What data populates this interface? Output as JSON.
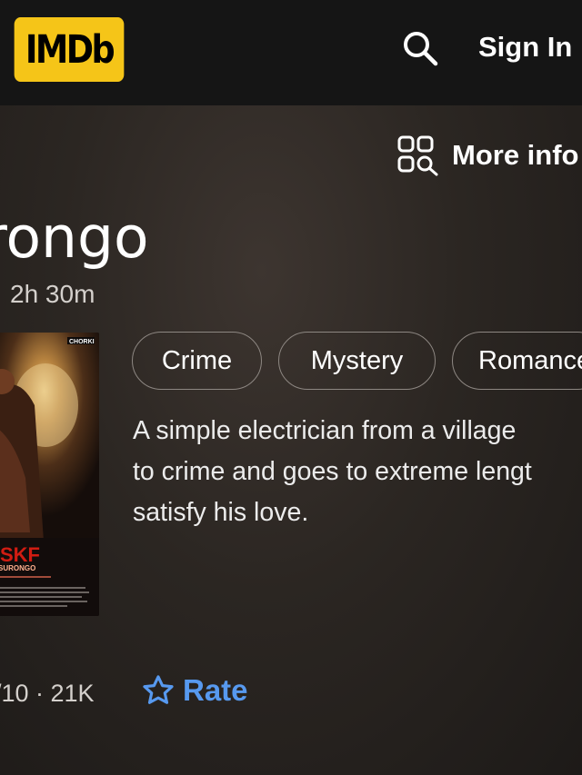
{
  "header": {
    "logo_text": "IMDb",
    "signin_label": "Sign In",
    "search_icon": "search-icon",
    "logo_color": "#f5c518"
  },
  "more_info": {
    "label": "More info",
    "icon": "more-info-icon"
  },
  "movie": {
    "title_partial": "rongo",
    "runtime": "2h 30m",
    "poster": {
      "corner_logo": "CHORKI",
      "title_text": "SURONGO"
    },
    "genres": [
      "Crime",
      "Mystery",
      "Romance"
    ],
    "description_lines": [
      "A simple electrician from a village",
      "to crime and goes to extreme lengt",
      "satisfy his love."
    ],
    "rating_partial": "/10 · 21K",
    "rate_label": "Rate"
  },
  "colors": {
    "accent_blue": "#5799ef",
    "header_bg": "#151515"
  }
}
